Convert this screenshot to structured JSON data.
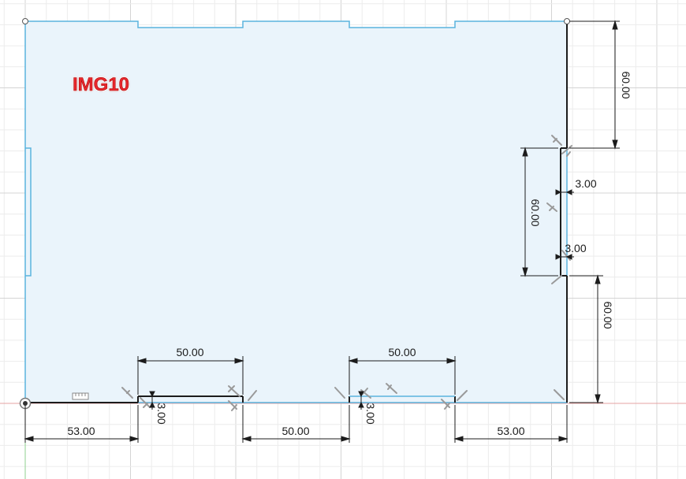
{
  "sketch": {
    "label": "IMG10"
  },
  "dimensions": {
    "bottom_left_width": "53.00",
    "bottom_mid_width": "50.00",
    "bottom_right_width": "53.00",
    "slot_left_width": "50.00",
    "slot_right_width": "50.00",
    "slot_left_depth": "3.00",
    "slot_right_depth": "3.00",
    "right_top_height": "60.00",
    "right_mid_height": "60.00",
    "right_bottom_height": "60.00",
    "right_slot_depth_top": "3.00",
    "right_slot_depth_bottom": "3.00"
  },
  "colors": {
    "profile_fill": "#eaf4fb",
    "profile_edge": "#5ab3de",
    "sketch_line": "#1c1c1c",
    "grid_minor": "#ececec",
    "grid_major": "#d4d4d4",
    "x_axis": "#e5a3a3",
    "y_axis": "#8fd28f",
    "label": "#e8262c"
  }
}
